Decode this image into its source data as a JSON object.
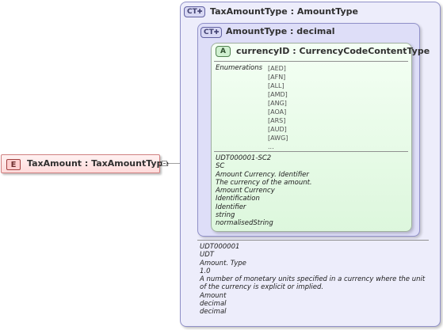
{
  "element": {
    "badge": "E",
    "name": "TaxAmount",
    "type": "TaxAmountType"
  },
  "complex_type": {
    "badge": "CT",
    "name": "TaxAmountType",
    "base": "AmountType",
    "annotations": [
      "UDT000001",
      "UDT",
      "Amount. Type",
      "1.0",
      "A number of monetary units specified in a currency where the unit of the currency is explicit or implied.",
      "Amount",
      "decimal",
      "decimal"
    ]
  },
  "base_type": {
    "badge": "CT",
    "name": "AmountType",
    "base": "decimal"
  },
  "attribute": {
    "badge": "A",
    "name": "currencyID",
    "type": "CurrencyCodeContentType",
    "enumerations_label": "Enumerations",
    "enumerations": [
      "[AED]",
      "[AFN]",
      "[ALL]",
      "[AMD]",
      "[ANG]",
      "[AOA]",
      "[ARS]",
      "[AUD]",
      "[AWG]",
      "..."
    ],
    "annotations": [
      "UDT000001-SC2",
      "SC",
      "Amount Currency. Identifier",
      "The currency of the amount.",
      "Amount Currency",
      "Identification",
      "Identifier",
      "string",
      "normalisedString"
    ]
  },
  "separator": ":",
  "colors": {
    "element_border": "#d08080",
    "complex_type_fill": "#ededfb",
    "attribute_fill": "#ddf7dd"
  }
}
